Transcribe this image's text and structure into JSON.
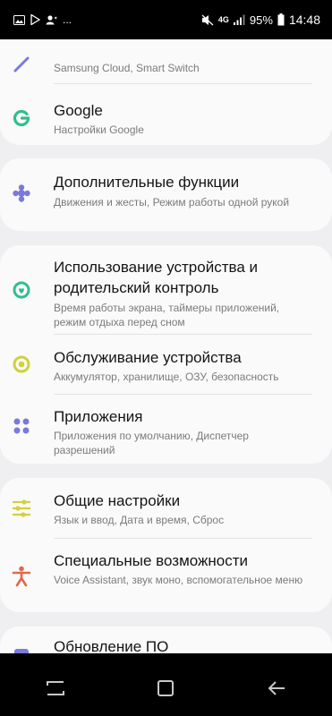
{
  "status_bar": {
    "notif_icons": [
      "gallery-icon",
      "play-store-icon",
      "account-icon"
    ],
    "overflow": "...",
    "mute_icon": "mute-icon",
    "network": "4G",
    "battery": "95%",
    "time": "14:48"
  },
  "settings": {
    "cloud": {
      "subtitle": "Samsung Cloud, Smart Switch"
    },
    "google": {
      "title": "Google",
      "subtitle": "Настройки Google"
    },
    "advanced": {
      "title": "Дополнительные функции",
      "subtitle": "Движения и жесты, Режим работы одной рукой"
    },
    "wellbeing": {
      "title": "Использование устройства и родительский контроль",
      "subtitle": "Время работы экрана, таймеры приложений, режим отдыха перед сном"
    },
    "device_care": {
      "title": "Обслуживание устройства",
      "subtitle": "Аккумулятор, хранилище, ОЗУ, безопасность"
    },
    "apps": {
      "title": "Приложения",
      "subtitle": "Приложения по умолчанию, Диспетчер разрешений"
    },
    "general": {
      "title": "Общие настройки",
      "subtitle": "Язык и ввод, Дата и время, Сброс"
    },
    "accessibility": {
      "title": "Специальные возможности",
      "subtitle": "Voice Assistant, звук моно, вспомогательное меню"
    },
    "update": {
      "title": "Обновление ПО"
    }
  },
  "colors": {
    "google": "#2fbf8b",
    "advanced": "#7c79dc",
    "wellbeing": "#2fbf8b",
    "device_care": "#cdd23a",
    "apps": "#7c79dc",
    "general": "#d3d23a",
    "accessibility": "#e06a4c",
    "update": "#7c79dc"
  }
}
